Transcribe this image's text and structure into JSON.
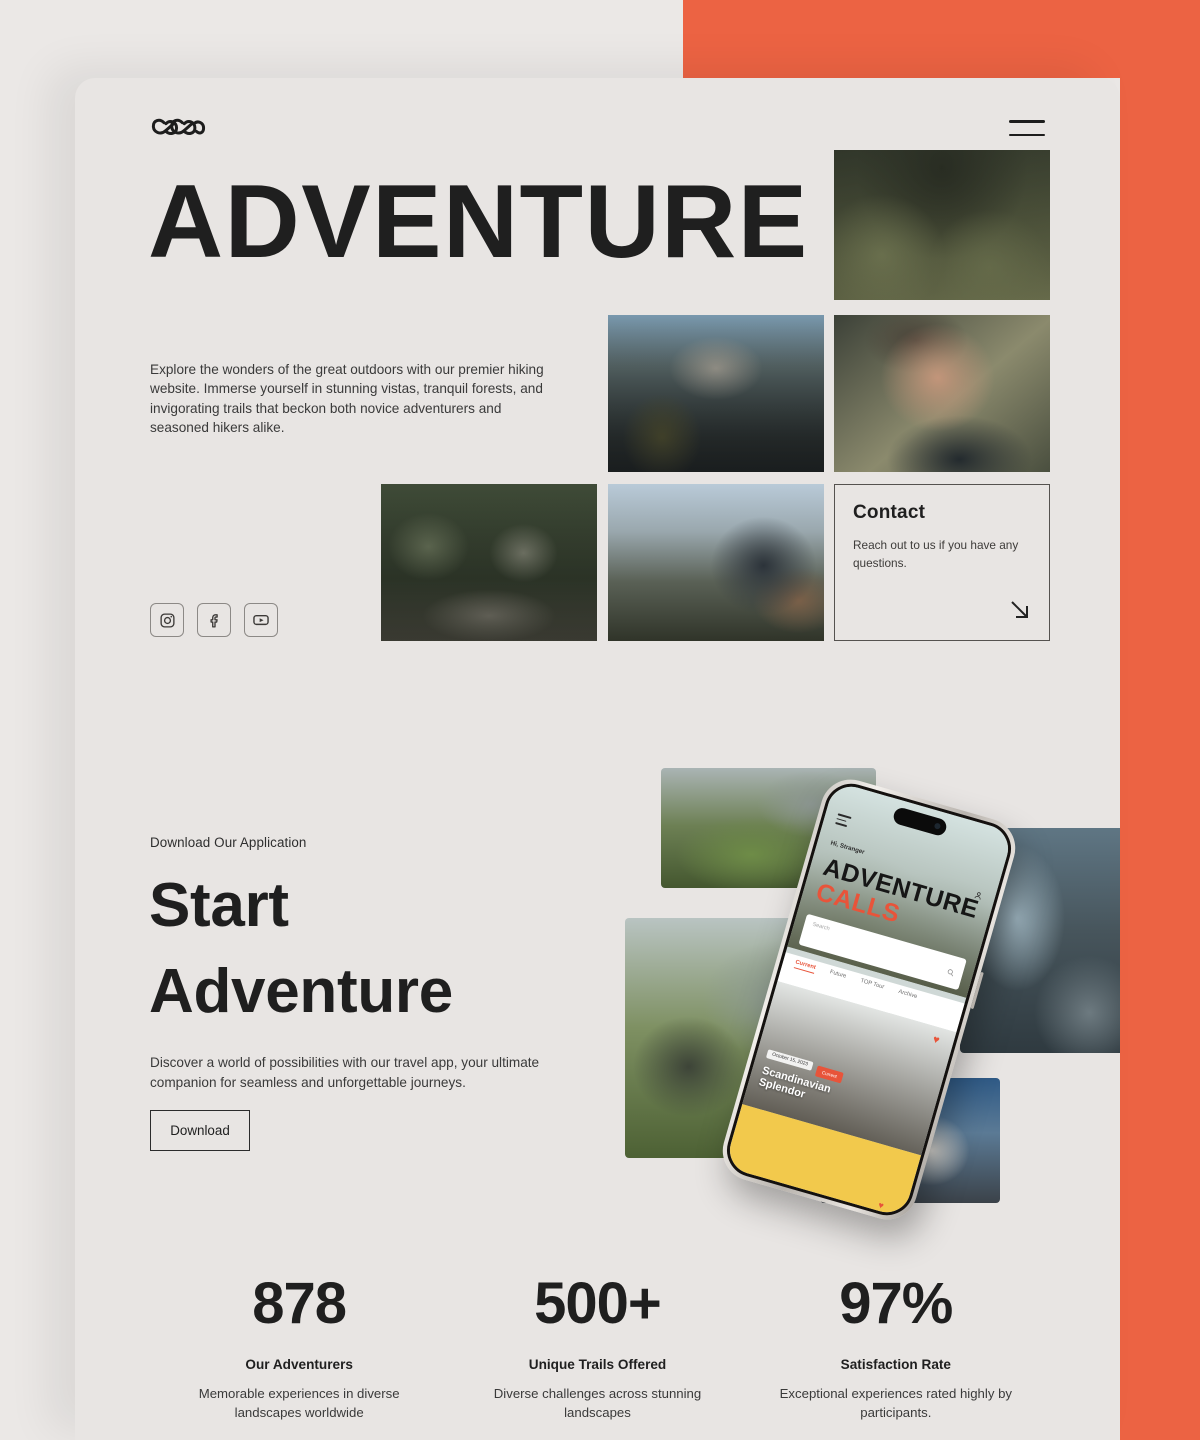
{
  "theme": {
    "accent_orange": "#EC6343",
    "page_bg": "#EBE8E6",
    "card_bg": "#E8E5E3",
    "text_dark": "#1F1F1F"
  },
  "header": {
    "logo_name": "infinity-chain-logo",
    "menu_label": "Menu"
  },
  "hero": {
    "title": "ADVENTURE",
    "paragraph": "Explore the wonders of the great outdoors with our premier hiking website. Immerse yourself in stunning vistas, tranquil forests, and invigorating trails that beckon both novice adventurers and seasoned hikers alike.",
    "socials": [
      {
        "name": "instagram",
        "label": "Instagram"
      },
      {
        "name": "facebook",
        "label": "Facebook"
      },
      {
        "name": "youtube",
        "label": "YouTube"
      }
    ],
    "images": [
      {
        "alt": "two hikers walking through a burnt pine forest"
      },
      {
        "alt": "two backpackers looking at a mountain peak"
      },
      {
        "alt": "close up portrait of a hiker looking up"
      },
      {
        "alt": "campers drinking coffee at a picnic table"
      },
      {
        "alt": "two hikers at sunrise on a ridge"
      }
    ],
    "contact": {
      "title": "Contact",
      "subtitle": "Reach out to us if you have any questions.",
      "arrow_icon": "arrow-down-right-icon"
    }
  },
  "app_section": {
    "eyebrow": "Download Our Application",
    "title_line1": "Start",
    "title_line2": "Adventure",
    "paragraph": "Discover a world of possibilities with our travel app, your ultimate companion for seamless and unforgettable journeys.",
    "download_label": "Download",
    "images": [
      {
        "alt": "green mountain ridge under clouds"
      },
      {
        "alt": "waterfall with a person standing on a rock"
      },
      {
        "alt": "hiker with backpack in an alpine meadow"
      },
      {
        "alt": "vintage airstream camper at dusk"
      }
    ],
    "phone": {
      "greeting": "Hi, Stranger",
      "headline_line1": "ADVENTURE",
      "headline_line2": "CALLS",
      "search_placeholder": "Search",
      "tabs": [
        "Current",
        "Future",
        "TOP Tour",
        "Archive"
      ],
      "active_tab": "Current",
      "card": {
        "date": "October 15, 2023",
        "badge": "Current",
        "title_line1": "Scandinavian",
        "title_line2": "Splendor"
      },
      "icons": {
        "menu": "hamburger-icon",
        "profile": "user-icon",
        "search": "search-icon",
        "favorite": "heart-icon"
      }
    }
  },
  "stats": [
    {
      "value": "878",
      "label": "Our Adventurers",
      "description": "Memorable experiences in diverse landscapes worldwide"
    },
    {
      "value": "500+",
      "label": "Unique Trails Offered",
      "description": "Diverse challenges across stunning landscapes"
    },
    {
      "value": "97%",
      "label": "Satisfaction Rate",
      "description": "Exceptional experiences rated highly by participants."
    }
  ]
}
